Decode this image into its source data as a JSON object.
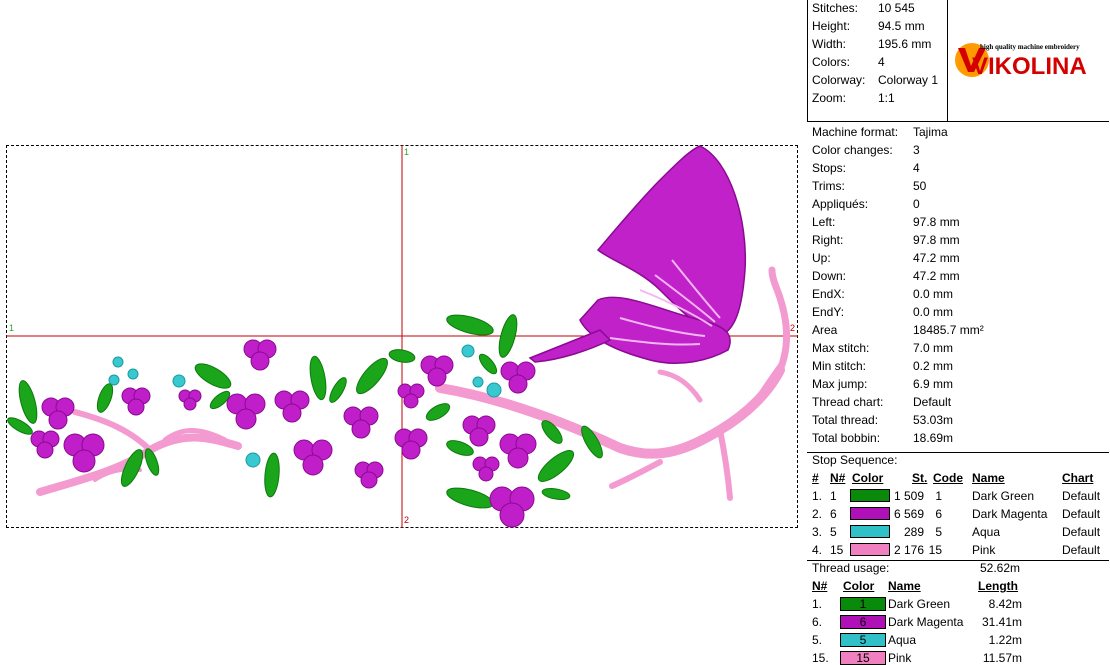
{
  "design": {
    "axis_labels": {
      "top": "1",
      "left": "1",
      "right": "2",
      "bottom": "2"
    }
  },
  "header_info": [
    {
      "label": "Stitches:",
      "value": "10 545"
    },
    {
      "label": "Height:",
      "value": "94.5 mm"
    },
    {
      "label": "Width:",
      "value": "195.6 mm"
    },
    {
      "label": "Colors:",
      "value": "4"
    },
    {
      "label": "Colorway:",
      "value": "Colorway 1"
    },
    {
      "label": "Zoom:",
      "value": "1:1"
    }
  ],
  "logo": {
    "brand": "VIKOLINA",
    "tagline": "high quality machine embroidery"
  },
  "machine_info": [
    {
      "label": "Machine format:",
      "value": "Tajima"
    },
    {
      "label": "Color changes:",
      "value": "3"
    },
    {
      "label": "Stops:",
      "value": "4"
    },
    {
      "label": "Trims:",
      "value": "50"
    },
    {
      "label": "Appliqués:",
      "value": "0"
    },
    {
      "label": "Left:",
      "value": "97.8 mm"
    },
    {
      "label": "Right:",
      "value": "97.8 mm"
    },
    {
      "label": "Up:",
      "value": "47.2 mm"
    },
    {
      "label": "Down:",
      "value": "47.2 mm"
    },
    {
      "label": "EndX:",
      "value": "0.0 mm"
    },
    {
      "label": "EndY:",
      "value": "0.0 mm"
    },
    {
      "label": "Area",
      "value": "18485.7 mm²"
    },
    {
      "label": "Max stitch:",
      "value": "7.0 mm"
    },
    {
      "label": "Min stitch:",
      "value": "0.2 mm"
    },
    {
      "label": "Max jump:",
      "value": "6.9 mm"
    },
    {
      "label": "Thread chart:",
      "value": "Default"
    },
    {
      "label": "Total thread:",
      "value": "53.03m"
    },
    {
      "label": "Total bobbin:",
      "value": "18.69m"
    }
  ],
  "stop_sequence": {
    "title": "Stop Sequence:",
    "headers": {
      "num": "#",
      "n": "N#",
      "color": "Color",
      "st": "St.",
      "code": "Code",
      "name": "Name",
      "chart": "Chart"
    },
    "rows": [
      {
        "num": "1.",
        "n": "1",
        "color": "#0a8a0a",
        "st": "1 509",
        "code": "1",
        "name": "Dark Green",
        "chart": "Default"
      },
      {
        "num": "2.",
        "n": "6",
        "color": "#b010b8",
        "st": "6 569",
        "code": "6",
        "name": "Dark Magenta",
        "chart": "Default"
      },
      {
        "num": "3.",
        "n": "5",
        "color": "#30c0c8",
        "st": "289",
        "code": "5",
        "name": "Aqua",
        "chart": "Default"
      },
      {
        "num": "4.",
        "n": "15",
        "color": "#f080c0",
        "st": "2 176",
        "code": "15",
        "name": "Pink",
        "chart": "Default"
      }
    ]
  },
  "thread_usage": {
    "label": "Thread usage:",
    "value": "52.62m",
    "headers": {
      "n": "N#",
      "color": "Color",
      "name": "Name",
      "length": "Length"
    },
    "rows": [
      {
        "n": "1.",
        "swatch": "1",
        "color": "#0a8a0a",
        "name": "Dark Green",
        "length": "8.42m"
      },
      {
        "n": "6.",
        "swatch": "6",
        "color": "#b010b8",
        "name": "Dark Magenta",
        "length": "31.41m"
      },
      {
        "n": "5.",
        "swatch": "5",
        "color": "#30c0c8",
        "name": "Aqua",
        "length": "1.22m"
      },
      {
        "n": "15.",
        "swatch": "15",
        "color": "#f080c0",
        "name": "Pink",
        "length": "11.57m"
      }
    ]
  }
}
